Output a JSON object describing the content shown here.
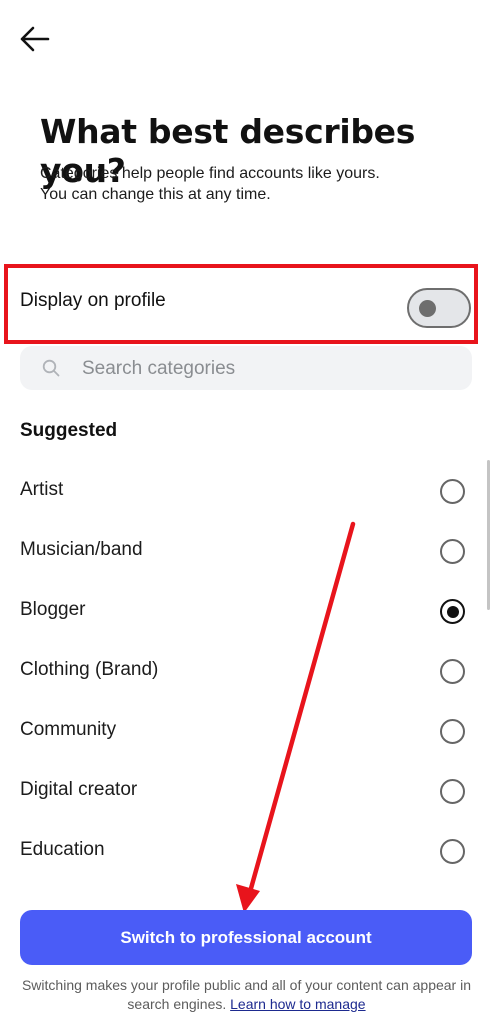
{
  "header": {
    "back_icon": "arrow-left-icon"
  },
  "title": "What best describes you?",
  "subtitle_lines": [
    "Categories help people find accounts like yours.",
    "You can change this at any time."
  ],
  "display_toggle": {
    "label": "Display on profile",
    "on": false
  },
  "search": {
    "placeholder": "Search categories",
    "value": "",
    "icon": "search-icon"
  },
  "section_heading": "Suggested",
  "categories": [
    {
      "label": "Artist",
      "selected": false
    },
    {
      "label": "Musician/band",
      "selected": false
    },
    {
      "label": "Blogger",
      "selected": true
    },
    {
      "label": "Clothing (Brand)",
      "selected": false
    },
    {
      "label": "Community",
      "selected": false
    },
    {
      "label": "Digital creator",
      "selected": false
    },
    {
      "label": "Education",
      "selected": false
    }
  ],
  "primary_button": {
    "label": "Switch to professional account"
  },
  "footer": {
    "text": "Switching makes your profile public and all of your content can appear in search engines.",
    "link": "Learn how to manage"
  },
  "colors": {
    "accent": "#4a5cf7",
    "annotation_red": "#e8141c"
  }
}
